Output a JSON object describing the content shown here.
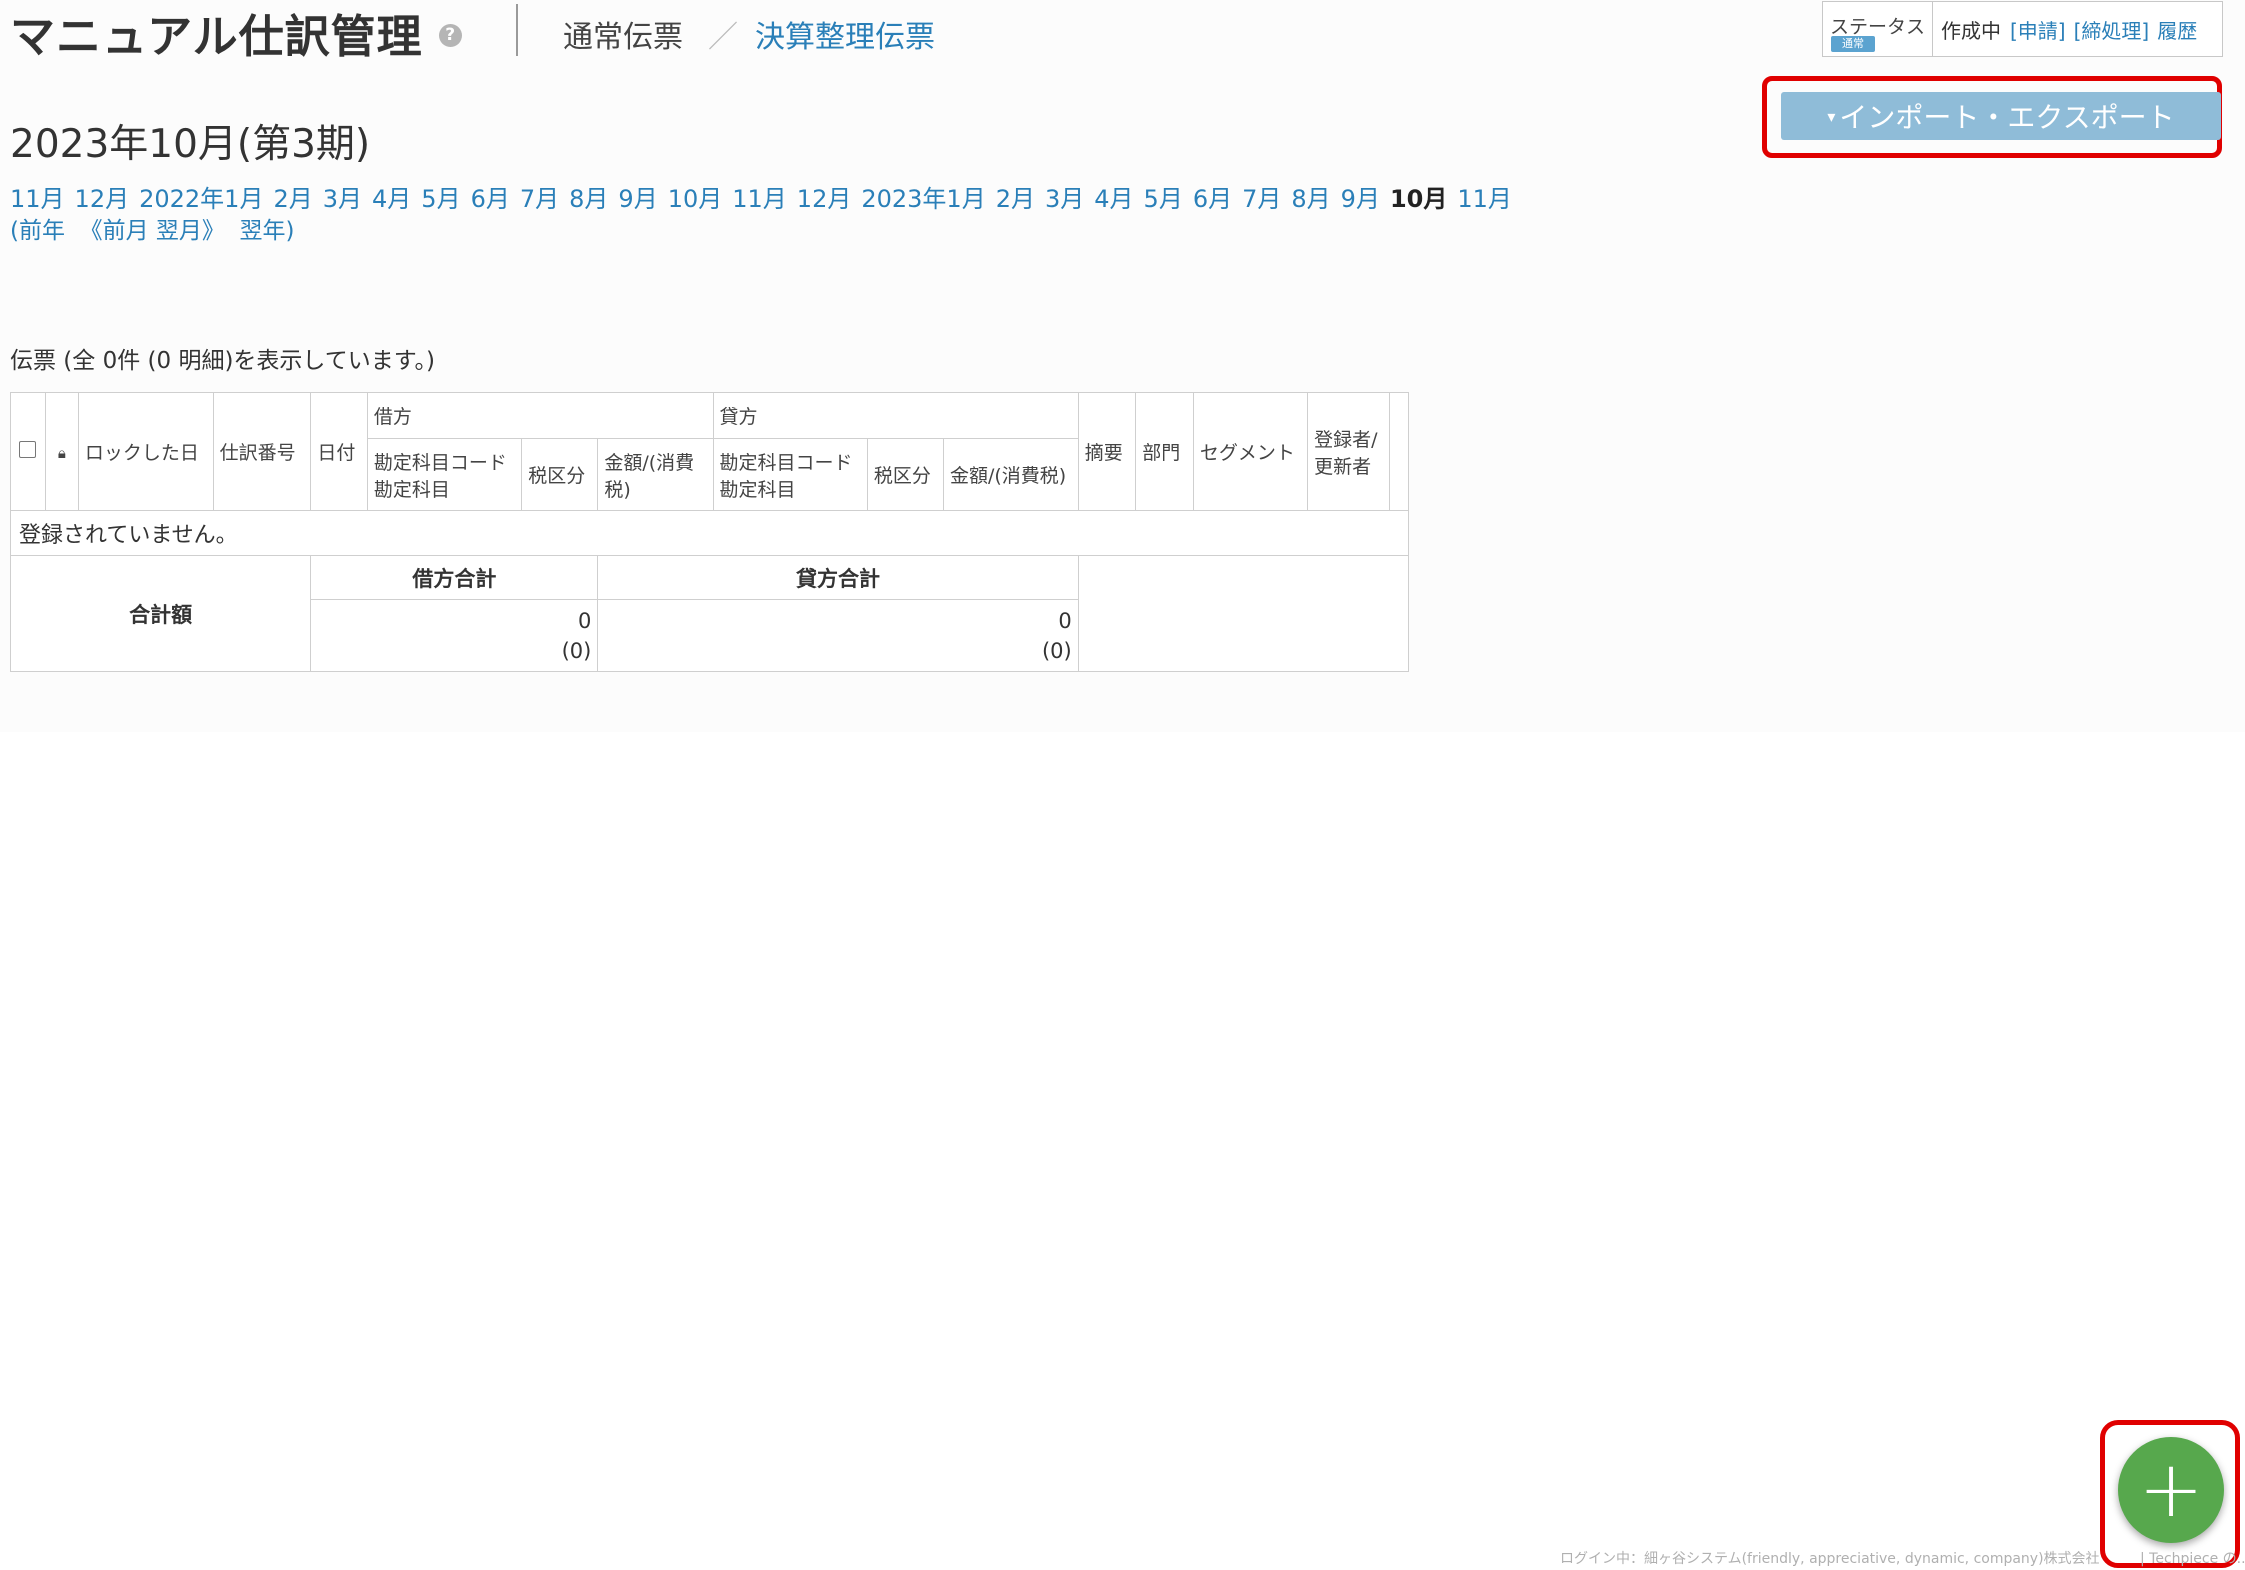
{
  "header": {
    "title": "マニュアル仕訳管理",
    "help_icon": "?",
    "tab_normal": "通常伝票",
    "tab_separator": "／",
    "tab_settlement": "決算整理伝票"
  },
  "status": {
    "label": "ステータス",
    "badge": "通常",
    "current": "作成中",
    "apply": "[申請]",
    "close": "[締処理]",
    "history": "履歴"
  },
  "import_export": {
    "caret": "▾",
    "label": "インポート・エクスポート"
  },
  "period": {
    "title": "2023年10月(第3期)",
    "months": [
      "11月",
      "12月",
      "2022年1月",
      "2月",
      "3月",
      "4月",
      "5月",
      "6月",
      "7月",
      "8月",
      "9月",
      "10月",
      "11月",
      "12月",
      "2023年1月",
      "2月",
      "3月",
      "4月",
      "5月",
      "6月",
      "7月",
      "8月",
      "9月"
    ],
    "current_month": "10月",
    "next_month": "11月",
    "year_nav": {
      "open_paren": "(",
      "prev_year": "前年",
      "prev_month": "《前月",
      "next_month": "翌月》",
      "next_year": "翌年",
      "close_paren": ")"
    }
  },
  "summary": "伝票 (全 0件 (0 明細)を表示しています。)",
  "table": {
    "headers": {
      "locked_date": "ロックした日",
      "journal_no": "仕訳番号",
      "date": "日付",
      "debit": "借方",
      "credit": "貸方",
      "account_code": "勘定科目コード",
      "account": "勘定科目",
      "tax_class": "税区分",
      "amount": "金額/(消費税)",
      "description": "摘要",
      "department": "部門",
      "segment": "セグメント",
      "registrant_1": "登録者/",
      "registrant_2": "更新者"
    },
    "empty_message": "登録されていません。",
    "totals": {
      "label": "合計額",
      "debit_total_label": "借方合計",
      "credit_total_label": "貸方合計",
      "debit_amount": "0",
      "debit_tax": "(0)",
      "credit_amount": "0",
      "credit_tax": "(0)"
    }
  },
  "fab": {
    "icon": "+"
  },
  "footer": {
    "login_text": "ログイン中：細ヶ谷システム(friendly, appreciative, dynamic, company)株式会社",
    "right_text": "| Techpiece の..."
  },
  "colors": {
    "link": "#2a7fb8",
    "import_button": "#8fbcd8",
    "fab": "#57a84d",
    "highlight": "#e00000",
    "status_badge": "#5ba3d0"
  }
}
